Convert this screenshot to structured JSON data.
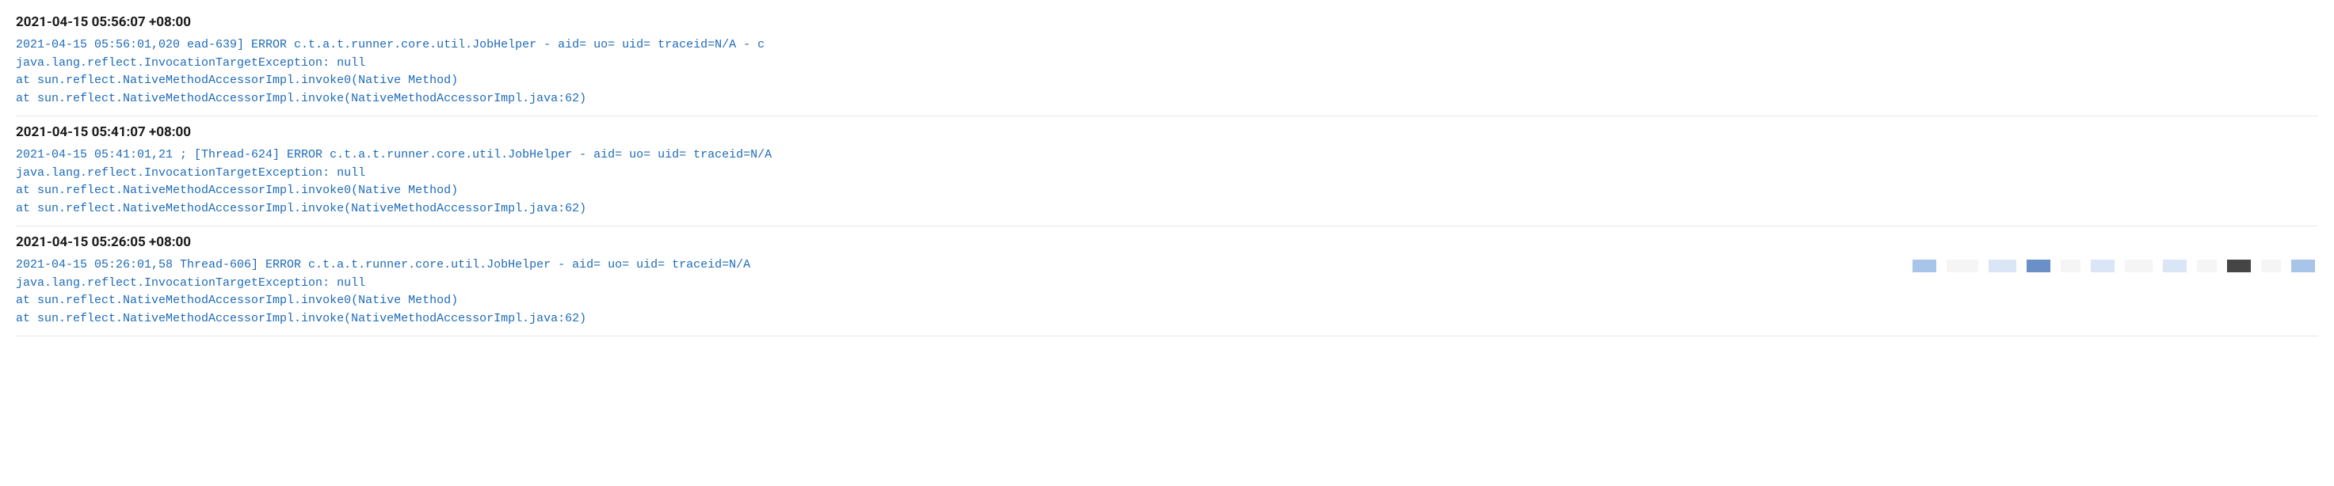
{
  "entries": [
    {
      "timestamp": "2021-04-15 05:56:07 +08:00",
      "lines": [
        "2021-04-15 05:56:01,020                              ead-639] ERROR c.t.a.t.runner.core.util.JobHelper - aid= uo= uid= traceid=N/A - c",
        "java.lang.reflect.InvocationTargetException: null",
        "at sun.reflect.NativeMethodAccessorImpl.invoke0(Native Method)",
        "at sun.reflect.NativeMethodAccessorImpl.invoke(NativeMethodAccessorImpl.java:62)"
      ]
    },
    {
      "timestamp": "2021-04-15 05:41:07 +08:00",
      "lines": [
        "2021-04-15 05:41:01,21                             ; [Thread-624] ERROR c.t.a.t.runner.core.util.JobHelper - aid= uo= uid= traceid=N/A",
        "java.lang.reflect.InvocationTargetException: null",
        "at sun.reflect.NativeMethodAccessorImpl.invoke0(Native Method)",
        "at sun.reflect.NativeMethodAccessorImpl.invoke(NativeMethodAccessorImpl.java:62)"
      ]
    },
    {
      "timestamp": "2021-04-15 05:26:05 +08:00",
      "lines": [
        "2021-04-15 05:26:01,58                              Thread-606] ERROR c.t.a.t.runner.core.util.JobHelper - aid= uo= uid= traceid=N/A",
        "java.lang.reflect.InvocationTargetException: null",
        "at sun.reflect.NativeMethodAccessorImpl.invoke0(Native Method)",
        "at sun.reflect.NativeMethodAccessorImpl.invoke(NativeMethodAccessorImpl.java:62)"
      ]
    }
  ],
  "redaction_colors": {
    "light_gray": "#e8e8e8",
    "med_gray": "#c4c4c4",
    "dark_gray": "#888888",
    "darker_gray": "#555555",
    "light_blue": "#dae6f5",
    "med_blue": "#a8c4e8",
    "dark_blue": "#6b8fc7",
    "near_white": "#f5f5f5"
  }
}
